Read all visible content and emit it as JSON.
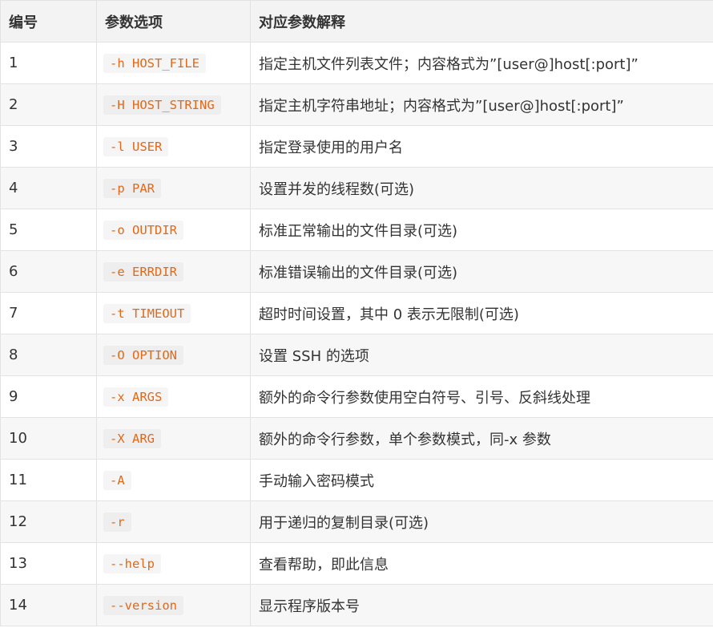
{
  "table": {
    "headers": [
      "编号",
      "参数选项",
      "对应参数解释"
    ],
    "rows": [
      {
        "num": "1",
        "option": "-h HOST_FILE",
        "desc": "指定主机文件列表文件；内容格式为”[user@]host[:port]”"
      },
      {
        "num": "2",
        "option": "-H HOST_STRING",
        "desc": "指定主机字符串地址；内容格式为”[user@]host[:port]”"
      },
      {
        "num": "3",
        "option": "-l USER",
        "desc": "指定登录使用的用户名"
      },
      {
        "num": "4",
        "option": "-p PAR",
        "desc": "设置并发的线程数(可选)"
      },
      {
        "num": "5",
        "option": "-o OUTDIR",
        "desc": "标准正常输出的文件目录(可选)"
      },
      {
        "num": "6",
        "option": "-e ERRDIR",
        "desc": "标准错误输出的文件目录(可选)"
      },
      {
        "num": "7",
        "option": "-t TIMEOUT",
        "desc": "超时时间设置，其中 0 表示无限制(可选)"
      },
      {
        "num": "8",
        "option": "-O OPTION",
        "desc": "设置 SSH 的选项"
      },
      {
        "num": "9",
        "option": "-x ARGS",
        "desc": "额外的命令行参数使用空白符号、引号、反斜线处理"
      },
      {
        "num": "10",
        "option": "-X ARG",
        "desc": "额外的命令行参数，单个参数模式，同-x 参数"
      },
      {
        "num": "11",
        "option": "-A",
        "desc": "手动输入密码模式"
      },
      {
        "num": "12",
        "option": "-r",
        "desc": "用于递归的复制目录(可选)"
      },
      {
        "num": "13",
        "option": "--help",
        "desc": "查看帮助，即此信息"
      },
      {
        "num": "14",
        "option": "--version",
        "desc": "显示程序版本号"
      }
    ]
  },
  "colors": {
    "code_text": "#e0691a",
    "header_bg": "#f3f3f3",
    "stripe_bg": "#f7f7f7",
    "border": "#e2e2e2"
  }
}
